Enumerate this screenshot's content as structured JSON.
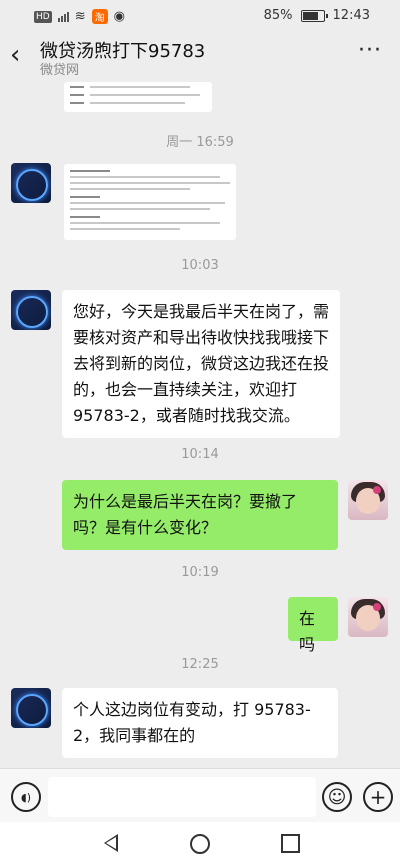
{
  "status_bar": {
    "hd_badge": "HD",
    "carrier_icons": "⁴⁶",
    "taobao_badge": "淘",
    "battery_percent": "85%",
    "battery_level": 0.85,
    "time": "12:43"
  },
  "header": {
    "back_icon": "chevron-left",
    "title": "微贷汤煦打下95783",
    "subtitle": "微贷网",
    "more_icon": "more-dots",
    "more_glyph": "···"
  },
  "messages": {
    "time_1": "周一 16:59",
    "time_2": "10:03",
    "msg_1": "您好，今天是我最后半天在岗了，需要核对资产和导出待收快找我哦接下去将到新的岗位，微贷这边我还在投的，也会一直持续关注，欢迎打 95783-2，或者随时找我交流。",
    "time_3": "10:14",
    "msg_2": "为什么是最后半天在岗？要撤了吗？是有什么变化？",
    "time_4": "10:19",
    "msg_3": "在吗",
    "time_5": "12:25",
    "msg_4": "个人这边岗位有变动，打 95783-2，我同事都在的"
  },
  "input_bar": {
    "voice_icon": "voice-icon",
    "emoji_icon": "emoji-icon",
    "plus_icon": "plus-icon",
    "input_value": "",
    "voice_glyph": "◖)",
    "emoji_glyph": "☺",
    "plus_glyph": "+"
  },
  "colors": {
    "background": "#ededed",
    "bubble_self": "#95ec69",
    "bubble_other": "#ffffff"
  }
}
